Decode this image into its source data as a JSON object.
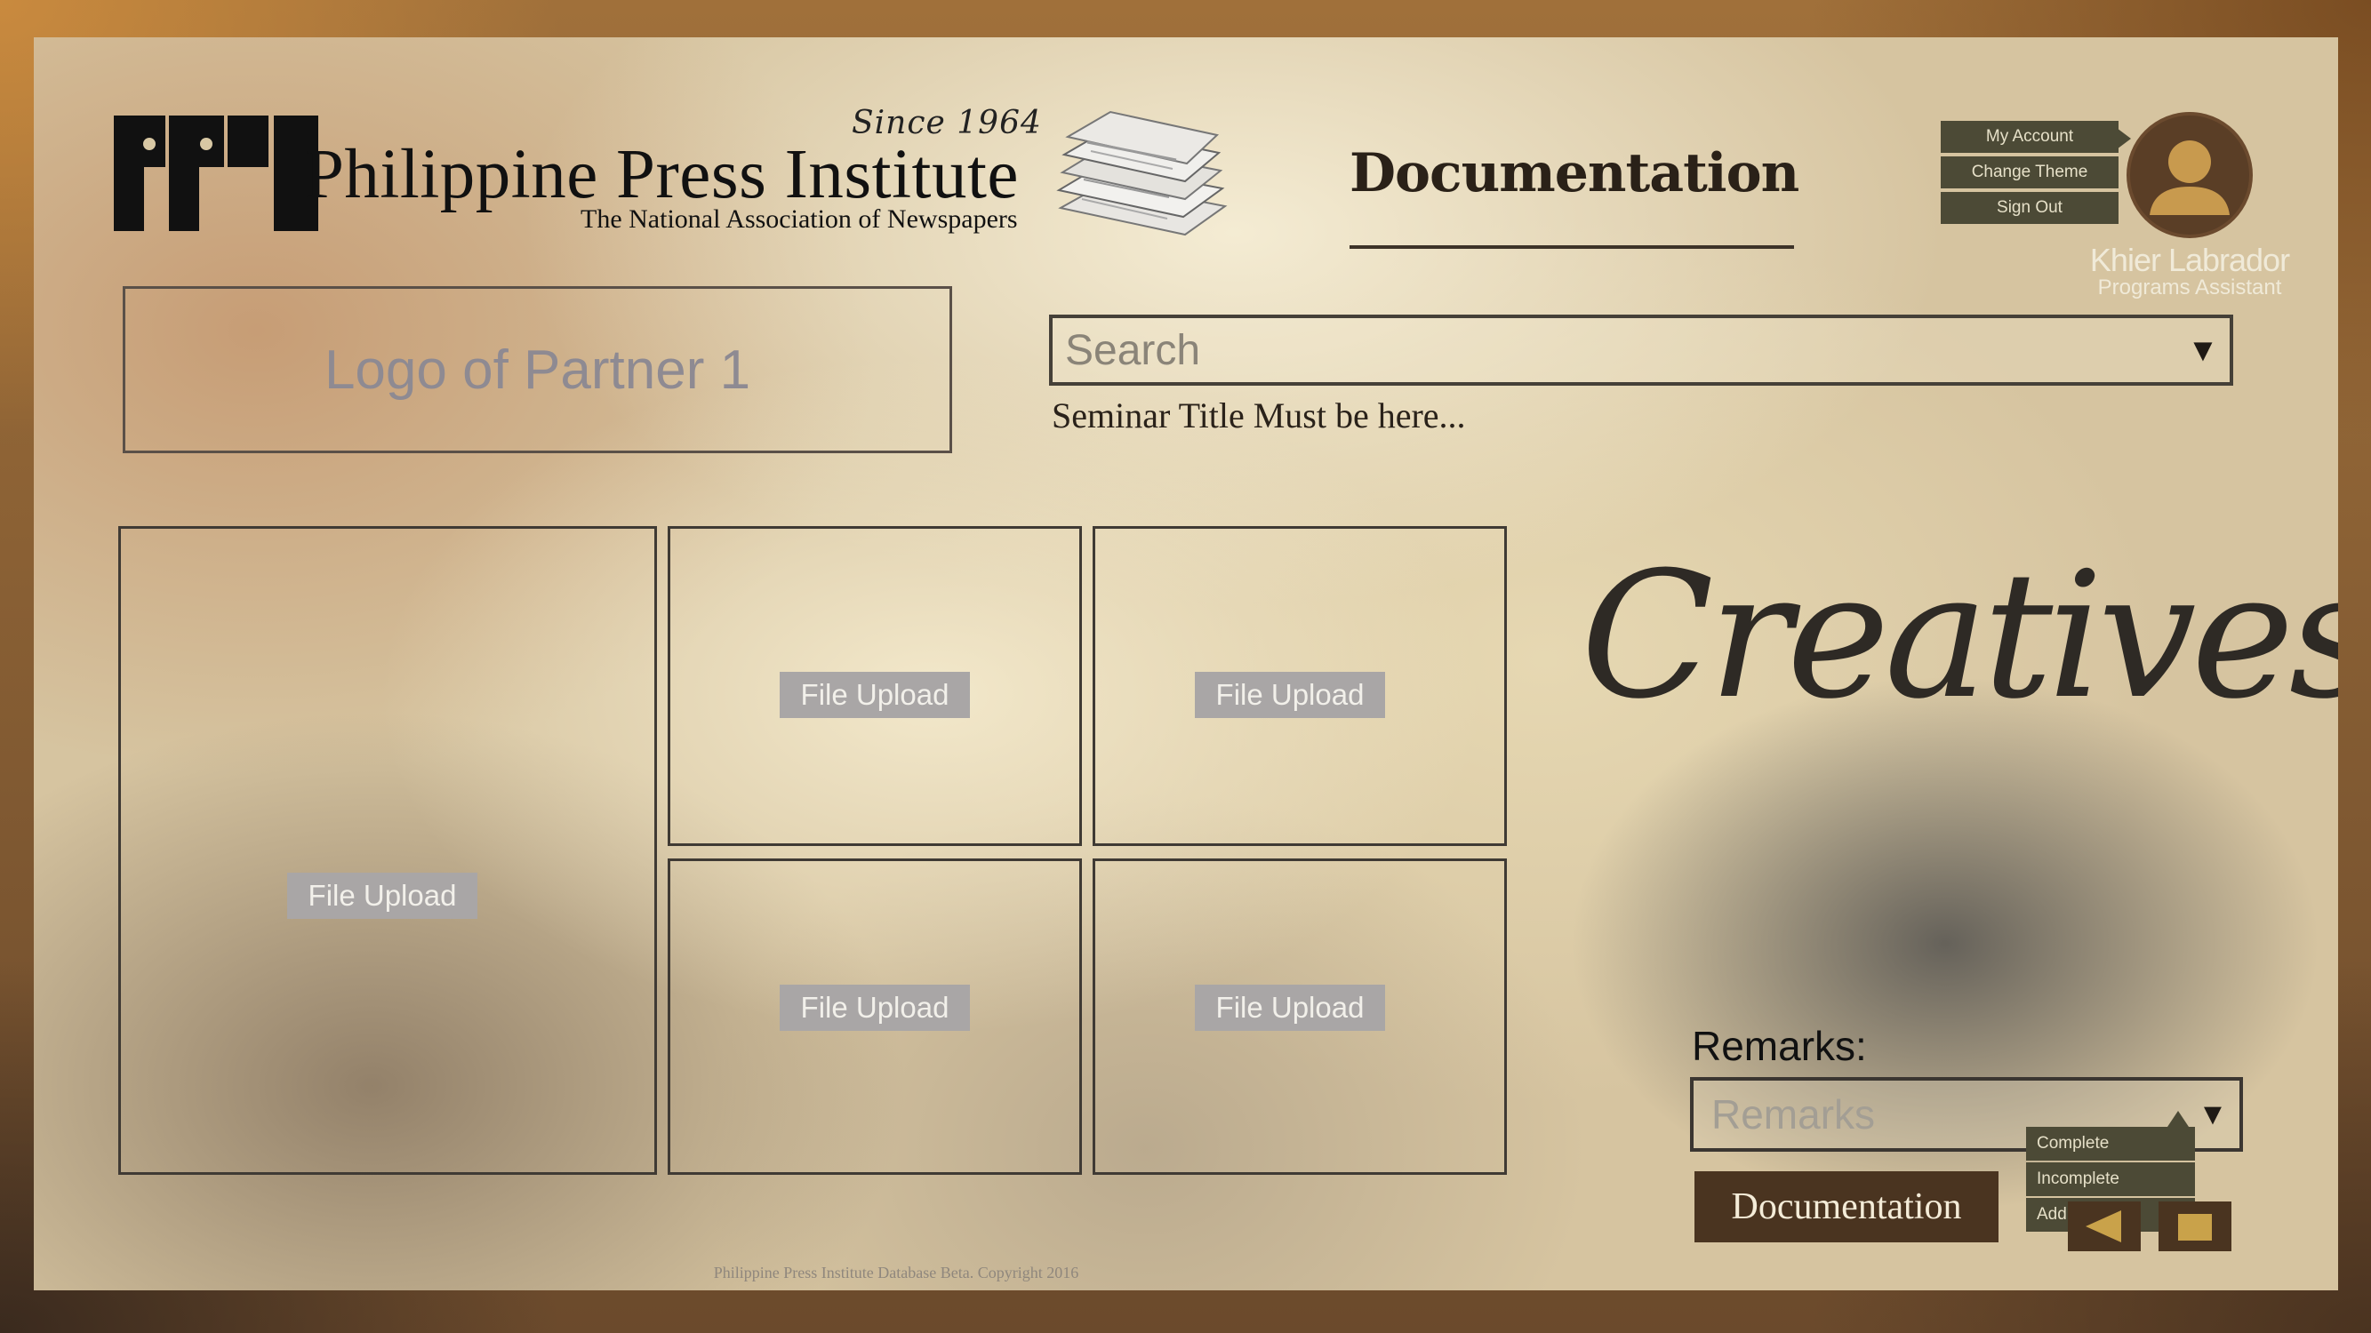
{
  "brand": {
    "logo_text": "PPI",
    "since": "Since 1964",
    "title": "Philippine Press Institute",
    "subtitle": "The National Association of Newspapers"
  },
  "page_title": "Documentation",
  "user_menu": {
    "items": [
      "My Account",
      "Change Theme",
      "Sign Out"
    ],
    "name": "Khier Labrador",
    "role": "Programs Assistant"
  },
  "partner_logo": "Logo of Partner 1",
  "search": {
    "placeholder": "Search"
  },
  "seminar_title": "Seminar Title Must be here...",
  "uploads": {
    "label": "File Upload",
    "count": 5
  },
  "creatives_heading": "Creatives",
  "remarks": {
    "label": "Remarks:",
    "placeholder": "Remarks",
    "options": [
      "Complete",
      "Incomplete",
      "Add..."
    ]
  },
  "documentation_button": "Documentation",
  "footer": "Philippine Press Institute Database Beta. Copyright 2016",
  "colors": {
    "menu_bg": "#4c4a36",
    "button_bg": "#4a3420",
    "upload_btn_bg": "#a9a6a6"
  }
}
